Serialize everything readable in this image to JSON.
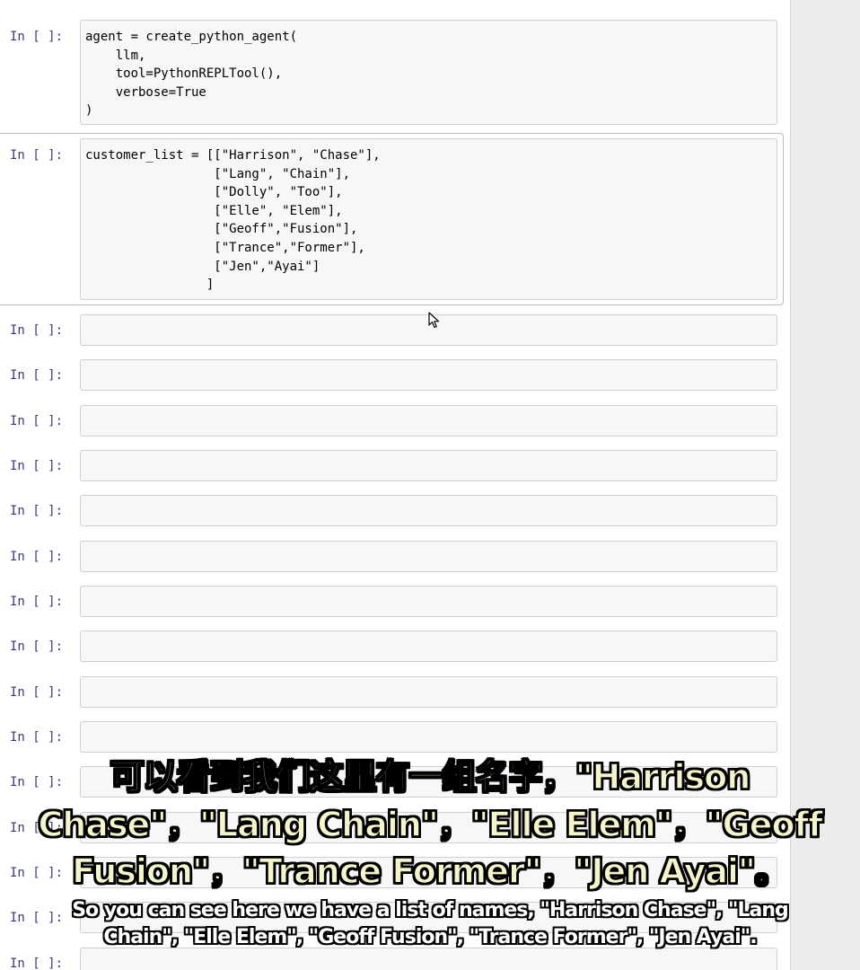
{
  "prompt_label": "In [ ]:",
  "cells": [
    {
      "prompt": "In [ ]:",
      "code_lines": [
        "agent = create_python_agent(",
        "    llm,",
        "    tool=PythonREPLTool(),",
        "    verbose=True",
        ")"
      ]
    },
    {
      "prompt": "In [ ]:",
      "code_lines": [
        "customer_list = [[\"Harrison\", \"Chase\"],",
        "                 [\"Lang\", \"Chain\"],",
        "                 [\"Dolly\", \"Too\"],",
        "                 [\"Elle\", \"Elem\"],",
        "                 [\"Geoff\",\"Fusion\"],",
        "                 [\"Trance\",\"Former\"],",
        "                 [\"Jen\",\"Ayai\"]",
        "                ]"
      ]
    }
  ],
  "empty_cells": [
    {
      "prompt": "In [ ]:"
    },
    {
      "prompt": "In [ ]:"
    },
    {
      "prompt": "In [ ]:"
    },
    {
      "prompt": "In [ ]:"
    },
    {
      "prompt": "In [ ]:"
    },
    {
      "prompt": "In [ ]:"
    },
    {
      "prompt": "In [ ]:"
    },
    {
      "prompt": "In [ ]:"
    },
    {
      "prompt": "In [ ]:"
    },
    {
      "prompt": "In [ ]:"
    },
    {
      "prompt": "In [ ]:"
    },
    {
      "prompt": "In [ ]:"
    },
    {
      "prompt": "In [ ]:"
    },
    {
      "prompt": "In [ ]:"
    },
    {
      "prompt": "In [ ]:"
    }
  ],
  "subtitles": {
    "zh_lines": [
      "可以看到我们这里有一组名字，\"Harrison",
      "Chase\"，\"Lang Chain\"，\"Elle Elem\"，\"Geoff",
      "Fusion\"，\"Trance Former\"，\"Jen Ayai\"。"
    ],
    "en_lines": [
      "So you can see here we have a list of names, \"Harrison Chase\", \"Lang",
      "Chain\", \"Elle Elem\", \"Geoff Fusion\", \"Trance Former\", \"Jen Ayai\"."
    ]
  },
  "colors": {
    "prompt": "#3a3a7a",
    "cell_background": "#f7f7f7",
    "cell_border": "#cfcfcf",
    "subtitle_zh": "#f5f5cc",
    "subtitle_en": "#ffffff"
  },
  "icons": {
    "cursor": "mouse-pointer-icon"
  }
}
